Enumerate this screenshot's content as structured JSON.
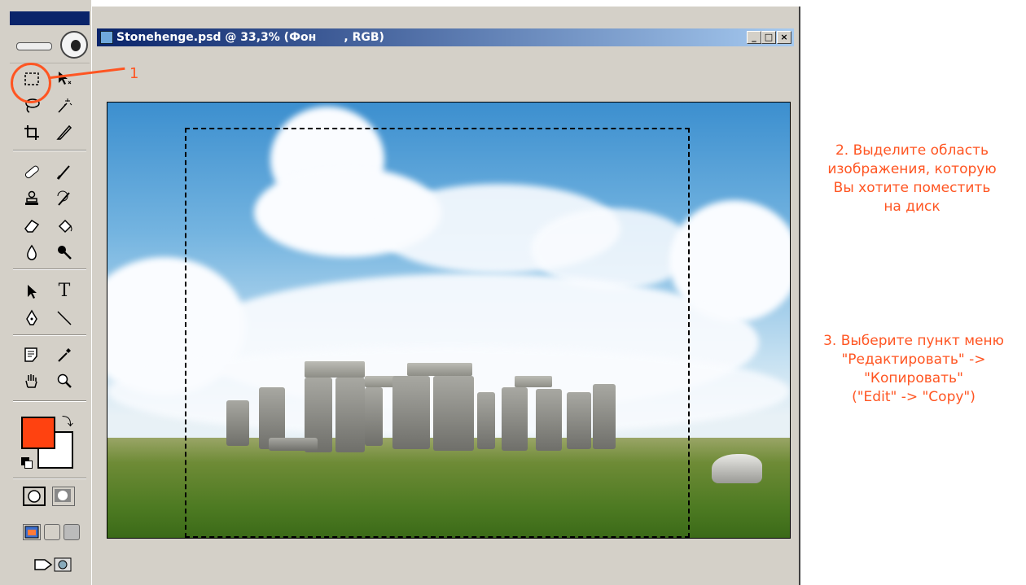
{
  "document": {
    "title": "Stonehenge.psd @ 33,3% (Фон       , RGB)",
    "minimize_label": "_",
    "maximize_label": "□",
    "close_label": "×"
  },
  "toolbox": {
    "foreground_color": "#ff4210",
    "background_color": "#ffffff",
    "type_tool_label": "T"
  },
  "annotations": {
    "step1": "1",
    "step2": "2. Выделите область\nизображения, которую\nВы хотите поместить\nна диск",
    "step3": "3. Выберите пункт меню\n\"Редактировать\" ->\n\"Копировать\"\n(\"Edit\" -> \"Copy\")"
  },
  "colors": {
    "annotation": "#ff5522",
    "titlebar": "#0a246a"
  }
}
